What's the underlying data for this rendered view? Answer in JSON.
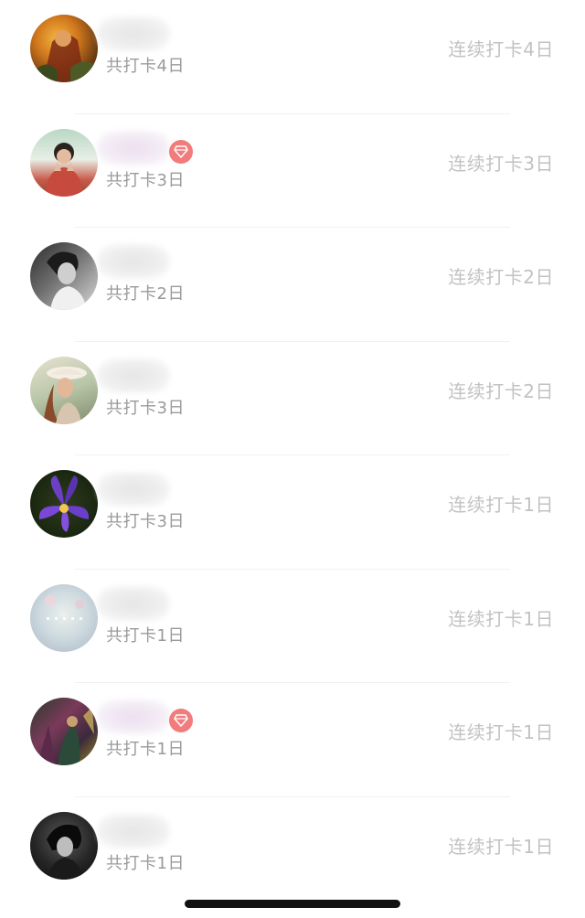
{
  "rows": [
    {
      "total": "共打卡4日",
      "streak": "连续打卡4日",
      "vip": false,
      "avatar_icon": "avatar-warrior-orange"
    },
    {
      "total": "共打卡3日",
      "streak": "连续打卡3日",
      "vip": true,
      "avatar_icon": "avatar-person-green"
    },
    {
      "total": "共打卡2日",
      "streak": "连续打卡2日",
      "vip": false,
      "avatar_icon": "avatar-person-bw"
    },
    {
      "total": "共打卡3日",
      "streak": "连续打卡2日",
      "vip": false,
      "avatar_icon": "avatar-girl-hat"
    },
    {
      "total": "共打卡3日",
      "streak": "连续打卡1日",
      "vip": false,
      "avatar_icon": "avatar-purple-flower"
    },
    {
      "total": "共打卡1日",
      "streak": "连续打卡1日",
      "vip": false,
      "avatar_icon": "avatar-pastel-blur"
    },
    {
      "total": "共打卡1日",
      "streak": "连续打卡1日",
      "vip": true,
      "avatar_icon": "avatar-dark-scene"
    },
    {
      "total": "共打卡1日",
      "streak": "连续打卡1日",
      "vip": false,
      "avatar_icon": "avatar-dark-portrait"
    }
  ],
  "colors": {
    "vip_badge": "#f27b7b",
    "total_text": "#9a9a9a",
    "streak_text": "#c2c2c2",
    "divider": "#f1f1f1"
  }
}
